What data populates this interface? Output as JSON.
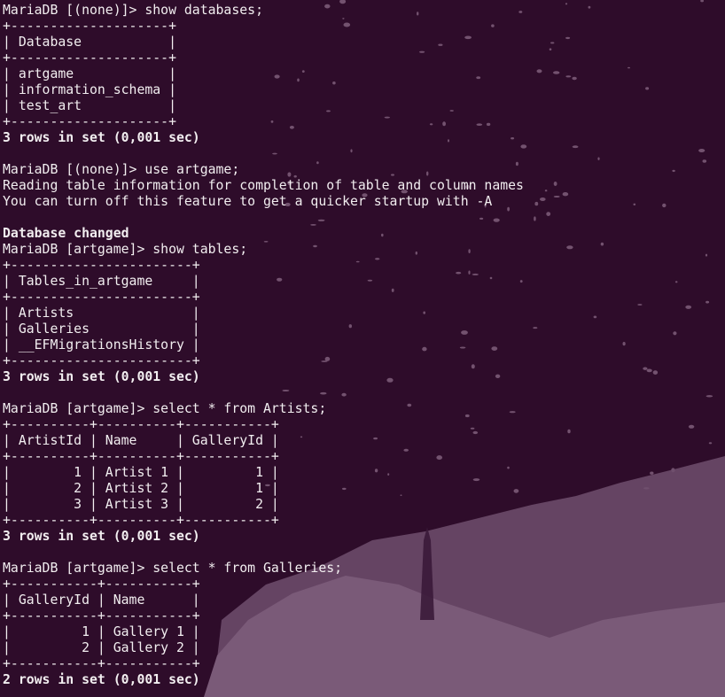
{
  "terminal": {
    "lines": [
      {
        "text": "MariaDB [(none)]> show databases;",
        "bold": false
      },
      {
        "text": "+--------------------+",
        "bold": false
      },
      {
        "text": "| Database           |",
        "bold": false
      },
      {
        "text": "+--------------------+",
        "bold": false
      },
      {
        "text": "| artgame            |",
        "bold": false
      },
      {
        "text": "| information_schema |",
        "bold": false
      },
      {
        "text": "| test_art           |",
        "bold": false
      },
      {
        "text": "+--------------------+",
        "bold": false
      },
      {
        "text": "3 rows in set (0,001 sec)",
        "bold": true
      },
      {
        "text": "",
        "bold": false
      },
      {
        "text": "MariaDB [(none)]> use artgame;",
        "bold": false
      },
      {
        "text": "Reading table information for completion of table and column names",
        "bold": false
      },
      {
        "text": "You can turn off this feature to get a quicker startup with -A",
        "bold": false
      },
      {
        "text": "",
        "bold": false
      },
      {
        "text": "Database changed",
        "bold": true
      },
      {
        "text": "MariaDB [artgame]> show tables;",
        "bold": false
      },
      {
        "text": "+-----------------------+",
        "bold": false
      },
      {
        "text": "| Tables_in_artgame     |",
        "bold": false
      },
      {
        "text": "+-----------------------+",
        "bold": false
      },
      {
        "text": "| Artists               |",
        "bold": false
      },
      {
        "text": "| Galleries             |",
        "bold": false
      },
      {
        "text": "| __EFMigrationsHistory |",
        "bold": false
      },
      {
        "text": "+-----------------------+",
        "bold": false
      },
      {
        "text": "3 rows in set (0,001 sec)",
        "bold": true
      },
      {
        "text": "",
        "bold": false
      },
      {
        "text": "MariaDB [artgame]> select * from Artists;",
        "bold": false
      },
      {
        "text": "+----------+----------+-----------+",
        "bold": false
      },
      {
        "text": "| ArtistId | Name     | GalleryId |",
        "bold": false
      },
      {
        "text": "+----------+----------+-----------+",
        "bold": false
      },
      {
        "text": "|        1 | Artist 1 |         1 |",
        "bold": false
      },
      {
        "text": "|        2 | Artist 2 |         1 |",
        "bold": false
      },
      {
        "text": "|        3 | Artist 3 |         2 |",
        "bold": false
      },
      {
        "text": "+----------+----------+-----------+",
        "bold": false
      },
      {
        "text": "3 rows in set (0,001 sec)",
        "bold": true
      },
      {
        "text": "",
        "bold": false
      },
      {
        "text": "MariaDB [artgame]> select * from Galleries;",
        "bold": false
      },
      {
        "text": "+-----------+-----------+",
        "bold": false
      },
      {
        "text": "| GalleryId | Name      |",
        "bold": false
      },
      {
        "text": "+-----------+-----------+",
        "bold": false
      },
      {
        "text": "|         1 | Gallery 1 |",
        "bold": false
      },
      {
        "text": "|         2 | Gallery 2 |",
        "bold": false
      },
      {
        "text": "+-----------+-----------+",
        "bold": false
      },
      {
        "text": "2 rows in set (0,001 sec)",
        "bold": true
      }
    ]
  },
  "colors": {
    "background": "#2e0c2a",
    "text": "#f2eef0",
    "art_fill": "#7a5a78"
  }
}
